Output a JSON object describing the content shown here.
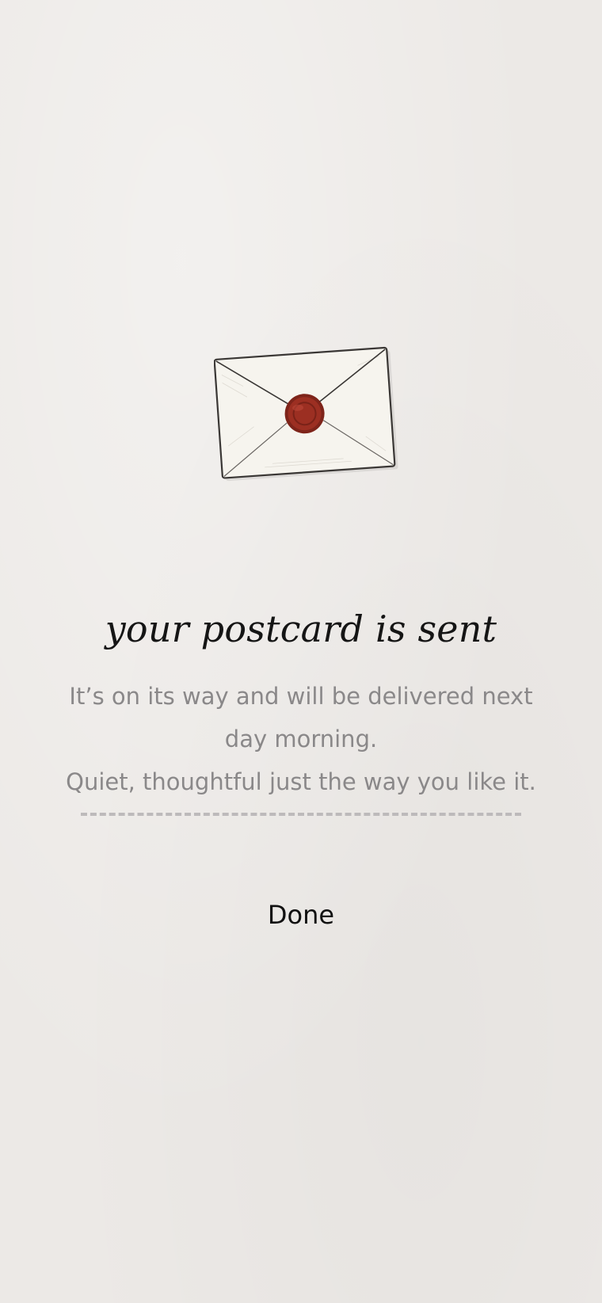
{
  "confirmation": {
    "title": "your postcard is sent",
    "message_lines": [
      "It’s on its way and will be delivered next",
      "day morning.",
      "Quiet, thoughtful just the way you like it."
    ],
    "done_label": "Done"
  },
  "illustration": {
    "icon": "sealed-envelope-icon",
    "seal_color": "#9c2f22",
    "paper_color": "#f6f4ee"
  },
  "colors": {
    "background": "#ece9e6",
    "title": "#151515",
    "message": "#8a8889",
    "button_text": "#111111"
  }
}
